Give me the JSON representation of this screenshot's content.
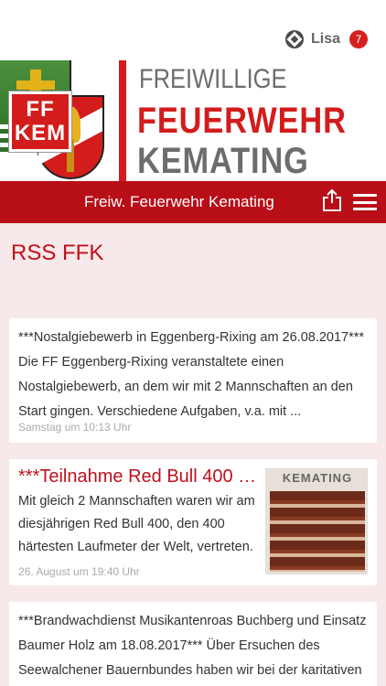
{
  "topbar": {
    "user_name": "Lisa",
    "badge_count": "7"
  },
  "header": {
    "title_line1": "FREIWILLIGE",
    "title_line2": "FEUERWEHR",
    "title_line3": "KEMATING",
    "logo_line1": "FF",
    "logo_line2": "KEM"
  },
  "navbar": {
    "title": "Freiw. Feuerwehr Kemating"
  },
  "page": {
    "title": "RSS FFK"
  },
  "feed": [
    {
      "text": "***Nostalgiebewerb in Eggenberg-Rixing am 26.08.2017*** Die FF Eggenberg-Rixing veranstaltete einen Nostalgiebewerb, an dem wir mit 2 Mannschaften an den Start gingen. Verschiedene Aufgaben, v.a. mit ...",
      "meta": "Samstag um 10:13 Uhr"
    },
    {
      "title": "***Teilnahme Red Bull 400 a...",
      "text": "Mit gleich 2 Mannschaften waren wir am diesjährigen Red Bull 400, den 400 härtesten Laufmeter der Welt, vertreten.",
      "meta": "26. August um 19:40 Uhr",
      "thumb_text": "KEMATING"
    },
    {
      "text": "***Brandwachdienst Musikantenroas Buchberg und Einsatz Baumer Holz am 18.08.2017*** Über Ersuchen des Seewalchener Bauernbundes haben wir bei der karitativen Musikantenroas unentgeltlich einen"
    }
  ],
  "colors": {
    "brand_red": "#b80e18",
    "background": "#f7e9e9",
    "accent_text": "#c0101d"
  }
}
